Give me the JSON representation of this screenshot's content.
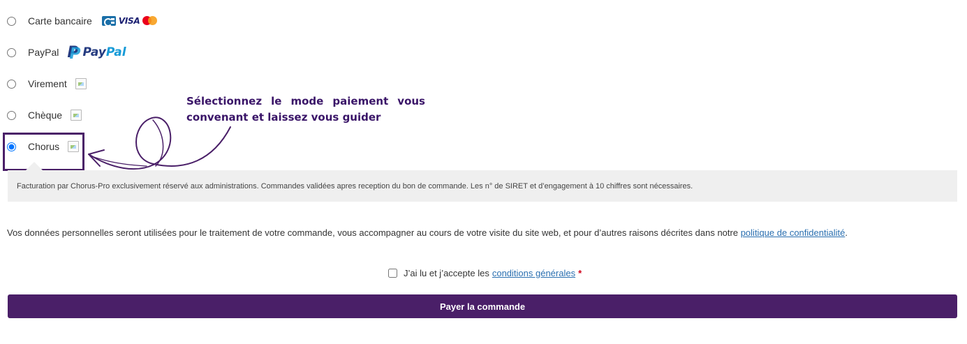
{
  "payment_methods": [
    {
      "label": "Carte bancaire",
      "selected": false,
      "logo": "cb-visa-mastercard"
    },
    {
      "label": "PayPal",
      "selected": false,
      "logo": "paypal"
    },
    {
      "label": "Virement",
      "selected": false,
      "logo": "broken-image"
    },
    {
      "label": "Chèque",
      "selected": false,
      "logo": "broken-image"
    },
    {
      "label": "Chorus",
      "selected": true,
      "logo": "broken-image"
    }
  ],
  "card_logos": {
    "visa": "VISA"
  },
  "paypal_logo": {
    "pay": "Pay",
    "pal": "Pal",
    "p": "P"
  },
  "annotation": "Sélectionnez le mode paiement vous convenant et laissez vous guider",
  "chorus_notice": "Facturation par Chorus-Pro exclusivement réservé aux administrations. Commandes validées apres reception du bon de commande. Les n° de SIRET et d’engagement à 10 chiffres sont nécessaires.",
  "privacy": {
    "text": "Vos données personnelles seront utilisées pour le traitement de votre commande, vous accompagner au cours de votre visite du site web, et pour d’autres raisons décrites dans notre",
    "link": "politique de confidentialité",
    "end": "."
  },
  "terms": {
    "text": "J’ai lu et j’accepte les",
    "link": "conditions générales",
    "required": "*",
    "checked": false
  },
  "submit_label": "Payer la commande",
  "colors": {
    "accent": "#4a1f68",
    "link": "#2a6fb0",
    "required": "#d0021b"
  }
}
